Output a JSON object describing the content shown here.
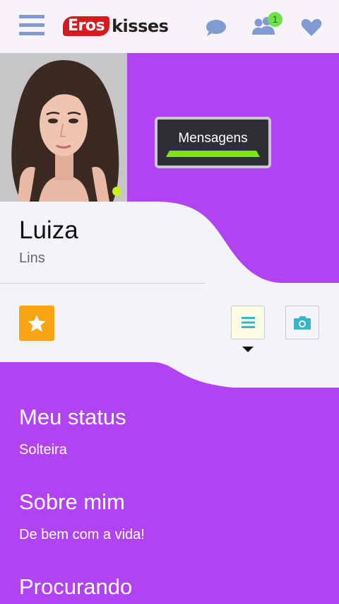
{
  "header": {
    "logo_part1": "Eros",
    "logo_part2": "kisses",
    "notification_count": "1",
    "icons": [
      "menu-icon",
      "chat-icon",
      "users-icon",
      "heart-icon"
    ]
  },
  "profile": {
    "name": "Luiza",
    "city": "Lins",
    "online": true,
    "messages_button": "Mensagens"
  },
  "sections": [
    {
      "title": "Meu status",
      "text": "Solteira"
    },
    {
      "title": "Sobre mim",
      "text": "De bem com a vida!"
    },
    {
      "title": "Procurando"
    }
  ],
  "colors": {
    "accent_purple": "#b143f3",
    "header_bg": "#f8f3f8",
    "icon_blue": "#7f9bd1",
    "star_orange": "#f8a514",
    "online_green": "#c8f01e",
    "message_bar_green": "#7ee31d"
  }
}
